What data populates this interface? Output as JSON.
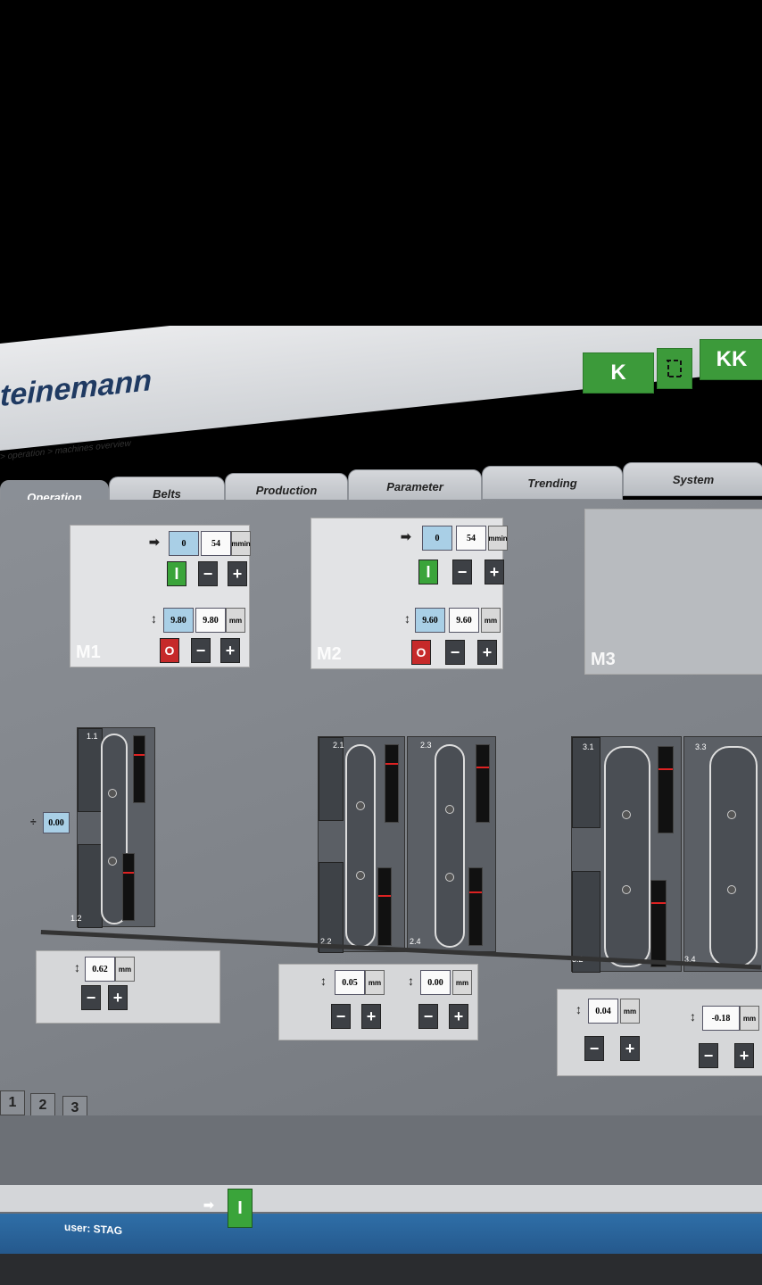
{
  "header": {
    "logo": "teinemann",
    "btn_k": "K",
    "btn_kk": "KK"
  },
  "breadcrumb": "> operation > machines overview",
  "tabs": [
    "Operation",
    "Belts",
    "Production",
    "Parameter",
    "Trending",
    "System"
  ],
  "machines": {
    "m1": {
      "label": "M1",
      "speed_set": "0",
      "speed_act": "54",
      "speed_unit_top": "m",
      "speed_unit_bottom": "min",
      "gap_set": "9.80",
      "gap_act": "9.80",
      "gap_unit": "mm",
      "on": "I",
      "off": "O",
      "minus": "−",
      "plus": "+"
    },
    "m2": {
      "label": "M2",
      "speed_set": "0",
      "speed_act": "54",
      "speed_unit_top": "m",
      "speed_unit_bottom": "min",
      "gap_set": "9.60",
      "gap_act": "9.60",
      "gap_unit": "mm",
      "on": "I",
      "off": "O",
      "minus": "−",
      "plus": "+"
    },
    "m3": {
      "label": "M3"
    }
  },
  "units": {
    "u1": {
      "top": "1.1",
      "bottom": "1.2",
      "side_value": "0.00"
    },
    "u2": {
      "a": "2.1",
      "b": "2.3",
      "c": "2.2",
      "d": "2.4"
    },
    "u3": {
      "a": "3.1",
      "b": "3.3",
      "c": "3.2",
      "d": "3.4"
    }
  },
  "adjust": {
    "p1": {
      "value": "0.62",
      "unit": "mm"
    },
    "p2a": {
      "value": "0.05",
      "unit": "mm"
    },
    "p2b": {
      "value": "0.00",
      "unit": "mm"
    },
    "p3a": {
      "value": "0.04",
      "unit": "mm"
    },
    "p3b": {
      "value": "-0.18",
      "unit": "mm"
    },
    "minus": "−",
    "plus": "+"
  },
  "machine_select": [
    "1",
    "2",
    "3"
  ],
  "footer": {
    "user": "user: STAG",
    "run": "I"
  }
}
